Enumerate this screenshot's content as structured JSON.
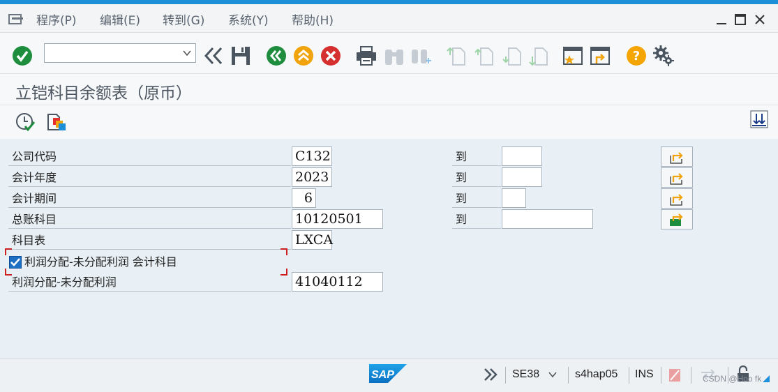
{
  "menu": {
    "items": [
      {
        "label": "程序(P)"
      },
      {
        "label": "编辑(E)"
      },
      {
        "label": "转到(G)"
      },
      {
        "label": "系统(Y)"
      },
      {
        "label": "帮助(H)"
      }
    ]
  },
  "toolbar": {
    "command_field_value": ""
  },
  "page": {
    "title": "立铠科目余额表（原币）"
  },
  "form": {
    "to_label": "到",
    "rows": [
      {
        "label": "公司代码",
        "from": "C132",
        "to": ""
      },
      {
        "label": "会计年度",
        "from": "2023",
        "to": ""
      },
      {
        "label": "会计期间",
        "from": "6",
        "to": ""
      },
      {
        "label": "总账科目",
        "from": "10120501",
        "to": ""
      },
      {
        "label": "科目表",
        "from": "LXCA"
      }
    ],
    "checkbox": {
      "label": "利润分配-未分配利润 会计科目",
      "checked": true
    },
    "extra_row": {
      "label": "利润分配-未分配利润",
      "value": "41040112"
    }
  },
  "status": {
    "transaction": "SE38",
    "system": "s4hap05",
    "mode": "INS",
    "logo": "SAP",
    "watermark": "CSDN @Hoo fk"
  },
  "colors": {
    "accent": "#1d8fd8",
    "check_green": "#1e8e3e",
    "cancel_red": "#d62f2f",
    "up_orange": "#f0a30a",
    "help_orange": "#f5a500"
  }
}
